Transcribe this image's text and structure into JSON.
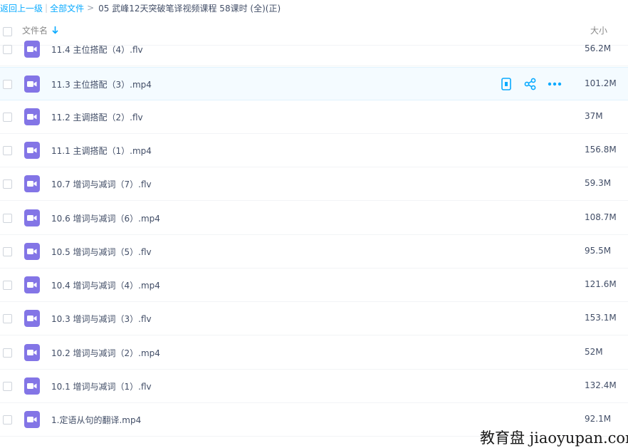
{
  "breadcrumb": {
    "back": "返回上一级",
    "separator": "|",
    "all_files": "全部文件",
    "arrow": ">",
    "current": "05 武峰12天突破笔译视频课程 58课时 (全)(正)"
  },
  "header": {
    "name_col": "文件名",
    "size_col": "大小",
    "sort_icon": "arrow-down-icon"
  },
  "files": [
    {
      "name": "11.4 主位搭配（4）.flv",
      "size": "56.2M",
      "icon": "video-file-icon"
    },
    {
      "name": "11.3 主位搭配（3）.mp4",
      "size": "101.2M",
      "icon": "video-file-icon"
    },
    {
      "name": "11.2 主调搭配（2）.flv",
      "size": "37M",
      "icon": "video-file-icon"
    },
    {
      "name": "11.1 主调搭配（1）.mp4",
      "size": "156.8M",
      "icon": "video-file-icon"
    },
    {
      "name": "10.7 增词与减词（7）.flv",
      "size": "59.3M",
      "icon": "video-file-icon"
    },
    {
      "name": "10.6 增词与减词（6）.mp4",
      "size": "108.7M",
      "icon": "video-file-icon"
    },
    {
      "name": "10.5 增词与减词（5）.flv",
      "size": "95.5M",
      "icon": "video-file-icon"
    },
    {
      "name": "10.4 增词与减词（4）.mp4",
      "size": "121.6M",
      "icon": "video-file-icon"
    },
    {
      "name": "10.3 增词与减词（3）.flv",
      "size": "153.1M",
      "icon": "video-file-icon"
    },
    {
      "name": "10.2 增词与减词（2）.mp4",
      "size": "52M",
      "icon": "video-file-icon"
    },
    {
      "name": "10.1 增词与减词（1）.flv",
      "size": "132.4M",
      "icon": "video-file-icon"
    },
    {
      "name": "1.定语从句的翻译.mp4",
      "size": "92.1M",
      "icon": "video-file-icon"
    }
  ],
  "hover_actions": [
    "phone-icon",
    "share-icon",
    "more-icon"
  ],
  "watermark": "教育盘 jiaoyupan.com",
  "colors": {
    "link": "#09aaff",
    "file_icon": "#8375e6",
    "action_icon": "#09aaff",
    "text": "#424e67"
  }
}
